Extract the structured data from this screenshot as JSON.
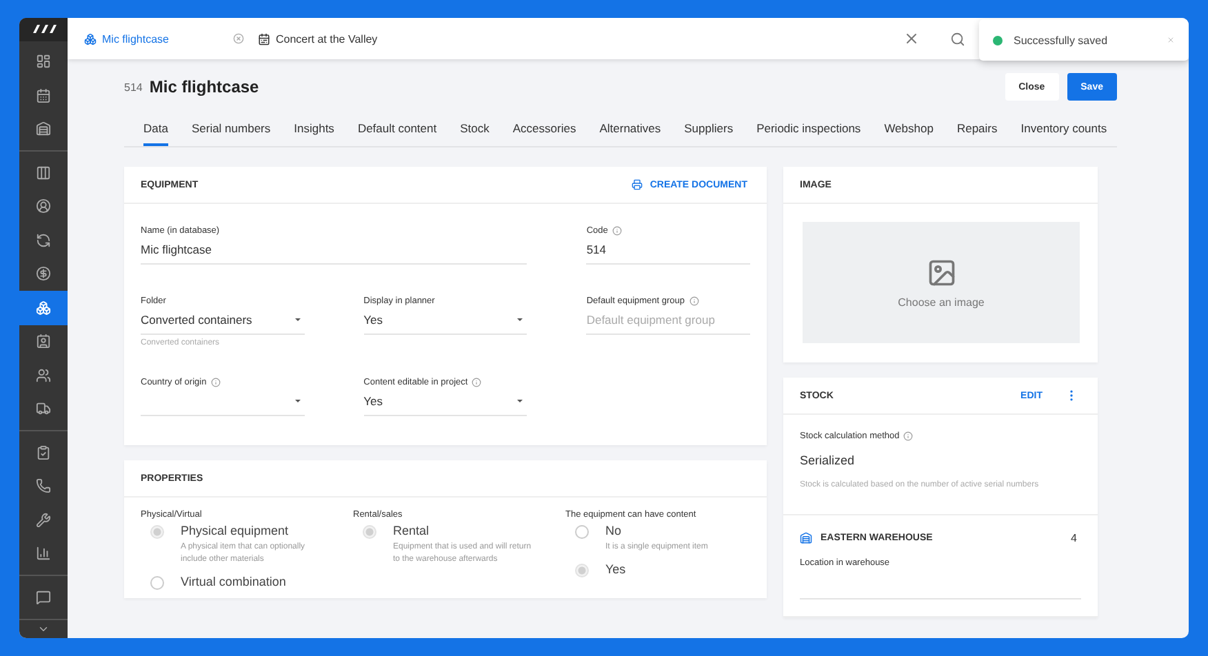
{
  "sidebar": {
    "groups": [
      {
        "items": [
          {
            "selected": false
          },
          {
            "selected": false
          },
          {
            "selected": false
          }
        ]
      },
      {
        "items": [
          {
            "selected": false
          },
          {
            "selected": false
          },
          {
            "selected": false
          },
          {
            "selected": false
          },
          {
            "selected": true
          },
          {
            "selected": false
          },
          {
            "selected": false
          },
          {
            "selected": false
          }
        ]
      },
      {
        "items": [
          {
            "selected": false
          },
          {
            "selected": false
          },
          {
            "selected": false
          },
          {
            "selected": false
          }
        ]
      },
      {
        "items": [
          {
            "selected": false
          }
        ]
      }
    ]
  },
  "open_tabs": [
    {
      "label": "Mic flightcase",
      "selected": true
    },
    {
      "label": "Concert at the Valley",
      "selected": false
    }
  ],
  "toast": {
    "message": "Successfully saved"
  },
  "header": {
    "code": "514",
    "title": "Mic flightcase",
    "buttons": [
      {
        "label": "Close",
        "kind": "secondary"
      },
      {
        "label": "Save",
        "kind": "primary"
      }
    ]
  },
  "tabs": [
    {
      "label": "Data",
      "selected": true
    },
    {
      "label": "Serial numbers",
      "selected": false
    },
    {
      "label": "Insights",
      "selected": false
    },
    {
      "label": "Default content",
      "selected": false
    },
    {
      "label": "Stock",
      "selected": false
    },
    {
      "label": "Accessories",
      "selected": false
    },
    {
      "label": "Alternatives",
      "selected": false
    },
    {
      "label": "Suppliers",
      "selected": false
    },
    {
      "label": "Periodic inspections",
      "selected": false
    },
    {
      "label": "Webshop",
      "selected": false
    },
    {
      "label": "Repairs",
      "selected": false
    },
    {
      "label": "Inventory counts",
      "selected": false
    }
  ],
  "equipment": {
    "title": "EQUIPMENT",
    "action": "CREATE DOCUMENT",
    "fields": [
      {
        "label": "Name (in database)",
        "value": "Mic flightcase",
        "kind": "text",
        "wide": true,
        "info": false
      },
      {
        "label": "Code",
        "value": "514",
        "kind": "text",
        "info": true
      },
      {
        "label": "Folder",
        "value": "Converted containers",
        "kind": "select",
        "hint": "Converted containers",
        "info": false
      },
      {
        "label": "Display in planner",
        "value": "Yes",
        "kind": "select",
        "info": false
      },
      {
        "label": "Default equipment group",
        "placeholder": "Default equipment group",
        "kind": "text",
        "info": true
      },
      {
        "label": "Country of origin",
        "kind": "select",
        "info": true
      },
      {
        "label": "Content editable in project",
        "value": "Yes",
        "kind": "select",
        "info": true
      }
    ]
  },
  "properties": {
    "title": "PROPERTIES",
    "groups": [
      {
        "label": "Physical/Virtual",
        "options": [
          {
            "label": "Physical equipment",
            "description": "A physical item that can optionally include other materials",
            "selected": true
          },
          {
            "label": "Virtual combination",
            "selected": false
          }
        ]
      },
      {
        "label": "Rental/sales",
        "options": [
          {
            "label": "Rental",
            "description": "Equipment that is used and will return to the warehouse afterwards",
            "selected": true
          }
        ]
      },
      {
        "label": "The equipment can have content",
        "options": [
          {
            "label": "No",
            "description": "It is a single equipment item",
            "selected": false
          },
          {
            "label": "Yes",
            "selected": true
          }
        ]
      }
    ]
  },
  "image": {
    "title": "IMAGE",
    "prompt": "Choose an image"
  },
  "stock": {
    "title": "STOCK",
    "action": "EDIT",
    "method_label": "Stock calculation method",
    "method_value": "Serialized",
    "method_hint": "Stock is calculated based on the number of active serial numbers",
    "warehouses": [
      {
        "name": "EASTERN WAREHOUSE",
        "count": "4",
        "location_label": "Location in warehouse"
      }
    ]
  }
}
